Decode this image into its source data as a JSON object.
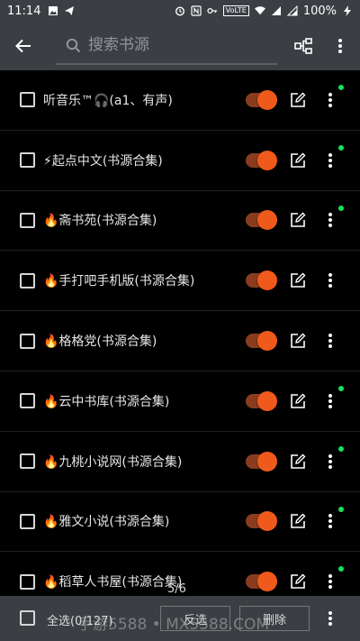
{
  "status_bar": {
    "time": "11:14",
    "lte_label": "VoLTE",
    "battery_percent": "100%"
  },
  "toolbar": {
    "search_placeholder": "搜索书源"
  },
  "sources": [
    {
      "label": "听音乐™🎧(a1、有声)",
      "enabled": true,
      "status_dot": true
    },
    {
      "label": "⚡起点中文(书源合集)",
      "enabled": true,
      "status_dot": true
    },
    {
      "label": "🔥斋书苑(书源合集)",
      "enabled": true,
      "status_dot": true
    },
    {
      "label": "🔥手打吧手机版(书源合集)",
      "enabled": true,
      "status_dot": false
    },
    {
      "label": "🔥格格党(书源合集)",
      "enabled": true,
      "status_dot": false
    },
    {
      "label": "🔥云中书库(书源合集)",
      "enabled": true,
      "status_dot": true
    },
    {
      "label": "🔥九桃小说网(书源合集)",
      "enabled": true,
      "status_dot": true
    },
    {
      "label": "🔥雅文小说(书源合集)",
      "enabled": true,
      "status_dot": true
    },
    {
      "label": "🔥稻草人书屋(书源合集)",
      "enabled": true,
      "status_dot": true
    }
  ],
  "page_indicator": "5/6",
  "bottom_bar": {
    "select_all_label": "全选(0/127)",
    "reverse_label": "反选",
    "delete_label": "删除"
  },
  "watermark": "手游5588 • MX5588.COM",
  "colors": {
    "bar_bg": "#3b3f44",
    "toggle_on": "#ef5a1c",
    "status_dot": "#13e35c"
  }
}
